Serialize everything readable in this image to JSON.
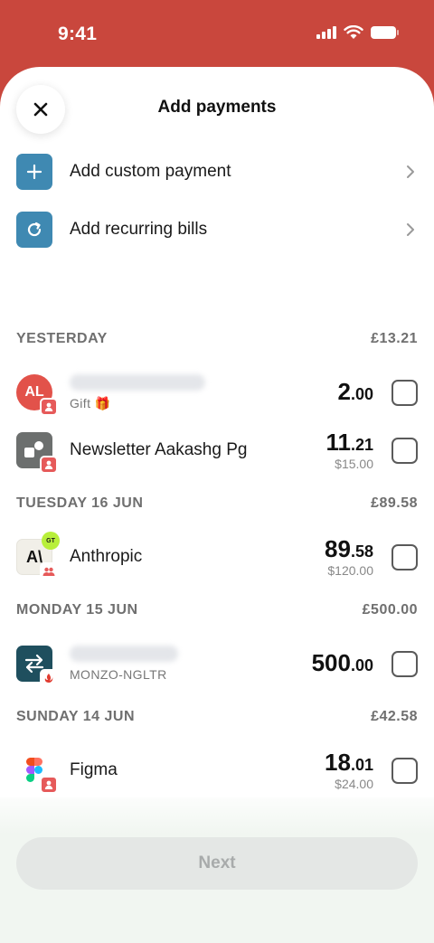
{
  "status_bar": {
    "time": "9:41"
  },
  "header": {
    "title": "Add payments"
  },
  "actions": [
    {
      "label": "Add custom payment",
      "icon": "plus-icon"
    },
    {
      "label": "Add recurring bills",
      "icon": "refresh-icon"
    }
  ],
  "sections": [
    {
      "label": "YESTERDAY",
      "total": "£13.21"
    },
    {
      "label": "TUESDAY 16 JUN",
      "total": "£89.58"
    },
    {
      "label": "MONDAY 15 JUN",
      "total": "£500.00"
    },
    {
      "label": "SUNDAY 14 JUN",
      "total": "£42.58"
    }
  ],
  "transactions": [
    {
      "initials": "AL",
      "sub": "Gift",
      "gift_emoji": "🎁",
      "amount_int": "2",
      "amount_dec": ".00",
      "original": ""
    },
    {
      "name": "Newsletter Aakashg Pg",
      "amount_int": "11",
      "amount_dec": ".21",
      "original": "$15.00"
    },
    {
      "logo_text": "A\\",
      "mini_badge": "GT",
      "name": "Anthropic",
      "amount_int": "89",
      "amount_dec": ".58",
      "original": "$120.00"
    },
    {
      "sub": "MONZO-NGLTR",
      "amount_int": "500",
      "amount_dec": ".00",
      "original": ""
    },
    {
      "name": "Figma",
      "amount_int": "18",
      "amount_dec": ".01",
      "original": "$24.00"
    }
  ],
  "footer": {
    "next_label": "Next"
  },
  "colors": {
    "brand_red": "#c9473d",
    "action_blue": "#3f89b2",
    "badge_red": "#e65a5a"
  }
}
